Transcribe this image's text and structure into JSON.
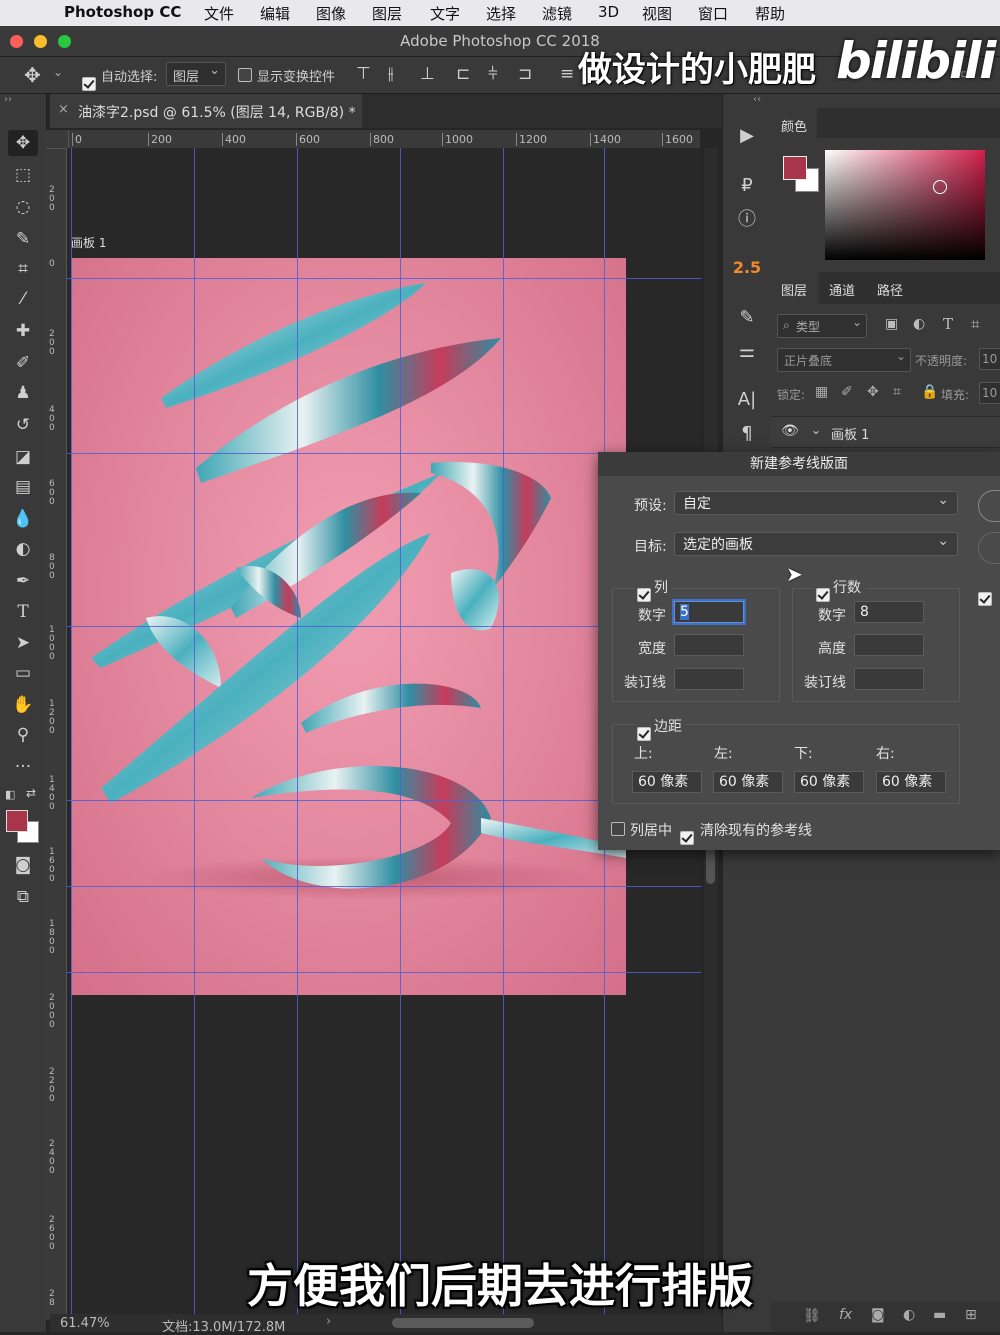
{
  "menubar": {
    "apple": "",
    "app": "Photoshop CC",
    "items": [
      "文件",
      "编辑",
      "图像",
      "图层",
      "文字",
      "选择",
      "滤镜",
      "3D",
      "视图",
      "窗口",
      "帮助"
    ]
  },
  "window": {
    "title": "Adobe Photoshop CC 2018"
  },
  "options": {
    "auto_select_label": "自动选择:",
    "auto_select_value": "图层",
    "show_transform_label": "显示变换控件"
  },
  "doc": {
    "tab_label": "油漆字2.psd @ 61.5% (图层 14, RGB/8) *",
    "artboard_label": "画板 1",
    "zoom": "61.47%",
    "doc_size": "文档:13.0M/172.8M"
  },
  "ruler": {
    "h_ticks": [
      "0",
      "200",
      "400",
      "600",
      "800",
      "1000",
      "1200",
      "1400",
      "1600"
    ],
    "v_ticks": [
      "2\n0\n0",
      "0",
      "2\n0\n0",
      "4\n0\n0",
      "6\n0\n0",
      "8\n0\n0",
      "1\n0\n0\n0",
      "1\n2\n0\n0",
      "1\n4\n0\n0",
      "1\n6\n0\n0",
      "1\n8\n0\n0",
      "2\n0\n0\n0",
      "2\n2\n0\n0",
      "2\n4\n0\n0",
      "2\n6\n0\n0",
      "2\n8"
    ]
  },
  "right_icons": {
    "value_badge": "2.5"
  },
  "color_panel": {
    "tab": "颜色",
    "fg_color": "#a8354a",
    "bg_color": "#ffffff",
    "hue": "#d0204a"
  },
  "layers_panel": {
    "tabs": [
      "图层",
      "通道",
      "路径"
    ],
    "filter_label": "类型",
    "blend_mode": "正片叠底",
    "opacity_label": "不透明度:",
    "opacity_value": "10",
    "lock_label": "锁定:",
    "fill_label": "填充:",
    "fill_value": "10",
    "layer_name": "画板 1"
  },
  "dialog": {
    "title": "新建参考线版面",
    "preset_label": "预设:",
    "preset_value": "自定",
    "target_label": "目标:",
    "target_value": "选定的画板",
    "columns": {
      "label": "列",
      "number_label": "数字",
      "number_value": "5",
      "width_label": "宽度",
      "width_value": "",
      "gutter_label": "装订线",
      "gutter_value": ""
    },
    "rows": {
      "label": "行数",
      "number_label": "数字",
      "number_value": "8",
      "height_label": "高度",
      "height_value": "",
      "gutter_label": "装订线",
      "gutter_value": ""
    },
    "margin": {
      "label": "边距",
      "top_label": "上:",
      "left_label": "左:",
      "bottom_label": "下:",
      "right_label": "右:",
      "top_value": "60 像素",
      "left_value": "60 像素",
      "bottom_value": "60 像素",
      "right_value": "60 像素"
    },
    "center_columns_label": "列居中",
    "clear_guides_label": "清除现有的参考线"
  },
  "overlay": {
    "watermark": "做设计的小肥肥",
    "bilibili": "bilibili",
    "subtitle": "方便我们后期去进行排版"
  }
}
